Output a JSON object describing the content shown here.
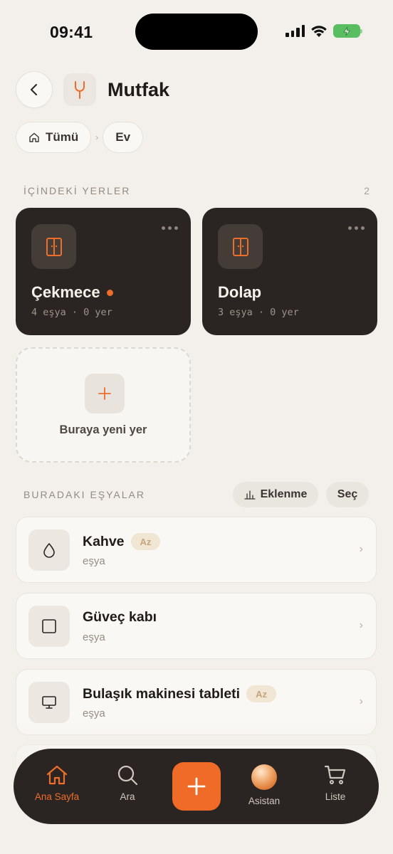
{
  "status_bar": {
    "time": "09:41"
  },
  "header": {
    "title": "Mutfak",
    "back_icon": "chevron-left-icon",
    "room_icon": "fork-icon"
  },
  "breadcrumb": [
    {
      "label": "Tümü",
      "icon": "home-icon"
    },
    {
      "label": "Ev"
    }
  ],
  "places_section": {
    "label": "İÇİNDEKİ YERLER",
    "count": "2"
  },
  "places": [
    {
      "name": "Çekmece",
      "meta": "4 eşya · 0 yer",
      "icon": "cabinet-icon",
      "has_dot": true
    },
    {
      "name": "Dolap",
      "meta": "3 eşya · 0 yer",
      "icon": "cabinet-icon",
      "has_dot": false
    }
  ],
  "add_place": {
    "label": "Buraya yeni yer"
  },
  "items_section": {
    "label": "BURADAKI EŞYALAR",
    "sort_label": "Eklenme",
    "select_label": "Seç"
  },
  "items": [
    {
      "name": "Kahve",
      "sub": "eşya",
      "badge": "Az",
      "icon": "drop-icon"
    },
    {
      "name": "Güveç kabı",
      "sub": "eşya",
      "badge": "",
      "icon": "square-icon"
    },
    {
      "name": "Bulaşık makinesi tableti",
      "sub": "eşya",
      "badge": "Az",
      "icon": "monitor-icon"
    }
  ],
  "tab_bar": {
    "tabs": [
      {
        "label": "Ana Sayfa",
        "icon": "home-icon",
        "active": true
      },
      {
        "label": "Ara",
        "icon": "search-icon",
        "active": false
      },
      {
        "label": "Asistan",
        "icon": "assistant-orb-icon",
        "active": false
      },
      {
        "label": "Liste",
        "icon": "cart-icon",
        "active": false
      }
    ]
  },
  "colors": {
    "accent": "#ef6b27",
    "card_dark": "#2a2522",
    "background": "#f3f0eb"
  }
}
